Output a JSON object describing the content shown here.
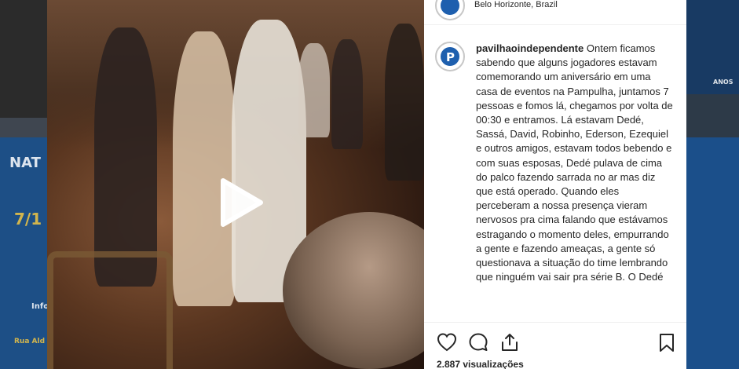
{
  "post": {
    "location": "Belo Horizonte, Brazil",
    "username": "pavilhaoindependente",
    "caption": "Ontem ficamos sabendo que alguns jogadores estavam comemorando um aniversário em uma casa de eventos na Pampulha, juntamos 7 pessoas e fomos lá, chegamos por volta de 00:30 e entramos. Lá estavam Dedé, Sassá, David, Robinho, Ederson, Ezequiel e outros amigos, estavam todos bebendo e com suas esposas, Dedé pulava de cima do palco fazendo sarrada no ar mas diz que está operado. Quando eles perceberam a nossa presença vieram nervosos pra cima falando que estávamos estragando o momento deles, empurrando a gente e fazendo ameaças, a gente só questionava a situação do time lembrando que ninguém vai sair pra série B. O Dedé",
    "views": "2.887 visualizações",
    "avatar_letter": "P"
  },
  "background": {
    "left_poster_text": "NAT",
    "left_poster_num": "7/1",
    "left_info": "Info",
    "left_street": "Rua Ald",
    "right_text": "ANOS"
  },
  "icons": {
    "play": "play-icon",
    "like": "heart-icon",
    "comment": "comment-icon",
    "share": "share-icon",
    "save": "bookmark-icon"
  },
  "colors": {
    "brand_blue": "#1e5fae",
    "text": "#262626"
  }
}
